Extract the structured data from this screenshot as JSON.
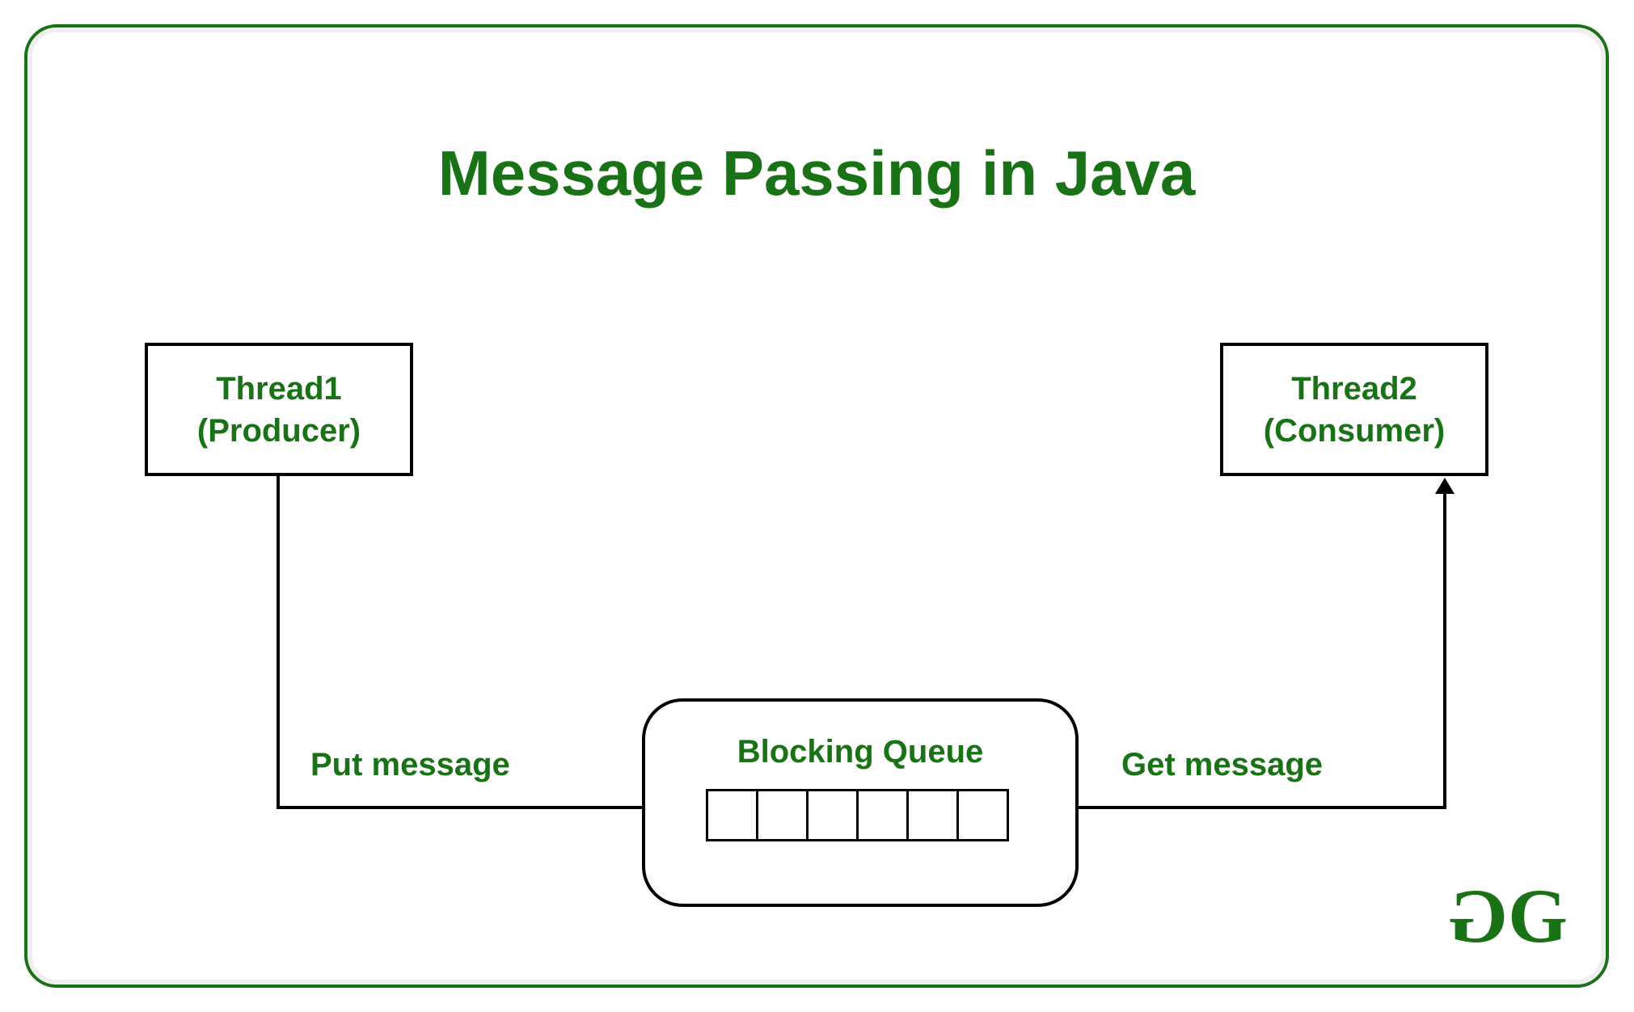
{
  "title": "Message Passing in Java",
  "nodes": {
    "thread1": {
      "line1": "Thread1",
      "line2": "(Producer)"
    },
    "thread2": {
      "line1": "Thread2",
      "line2": "(Consumer)"
    },
    "queue": {
      "label": "Blocking Queue",
      "cell_count": 6
    }
  },
  "edges": {
    "put": {
      "label": "Put message",
      "from": "thread1",
      "to": "queue"
    },
    "get": {
      "label": "Get message",
      "from": "queue",
      "to": "thread2"
    }
  },
  "colors": {
    "accent": "#1a7216",
    "stroke": "#000000"
  },
  "logo": "GG"
}
